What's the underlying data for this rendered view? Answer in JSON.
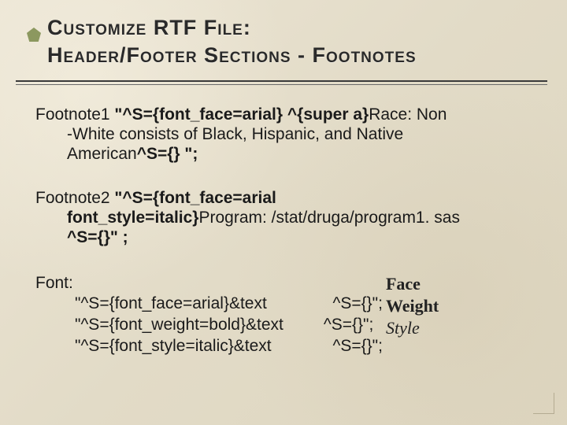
{
  "title": {
    "line1": "Customize RTF File:",
    "line2": "Header/Footer Sections - Footnotes"
  },
  "footnote1": {
    "label": "Footnote1 ",
    "code": "\"^S={font_face=arial} ^{super a}",
    "text_line1_rest": "Race: Non",
    "text_line2": "-White consists of Black, Hispanic, and Native",
    "text_line3": "American",
    "tail": "^S={} \";"
  },
  "footnote2": {
    "label": "Footnote2 ",
    "code_line1": "\"^S={font_face=arial",
    "code_line2": "font_style=italic}",
    "text_line2_rest": "Program: /stat/druga/program1. sas",
    "tail": "^S={}\" ;"
  },
  "font_section": {
    "heading": "Font:",
    "rows": [
      {
        "code": "\"^S={font_face=arial}&text",
        "suffix": "   ^S={}\";"
      },
      {
        "code": "\"^S={font_weight=bold}&text",
        "suffix": " ^S={}\";"
      },
      {
        "code": "\"^S={font_style=italic}&text",
        "suffix": "   ^S={}\";"
      }
    ],
    "labels": [
      "Face",
      "Weight",
      "Style"
    ]
  }
}
